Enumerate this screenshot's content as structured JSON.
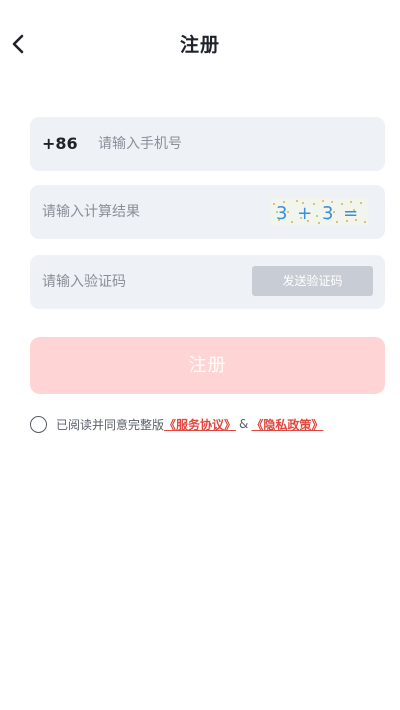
{
  "header": {
    "title": "注册"
  },
  "form": {
    "phone": {
      "prefix": "+86",
      "placeholder": "请输入手机号"
    },
    "calc": {
      "placeholder": "请输入计算结果",
      "captcha_text": "3 + 3 ="
    },
    "code": {
      "placeholder": "请输入验证码",
      "send_label": "发送验证码"
    },
    "submit_label": "注册"
  },
  "agreement": {
    "prefix": "已阅读并同意完整版",
    "service_link": "《服务协议》",
    "separator": "&",
    "privacy_link": "《隐私政策》"
  },
  "colors": {
    "field_bg": "#eef1f5",
    "submit_bg": "#ffd4d4",
    "send_bg": "#c8ccd4",
    "link": "#e2473f"
  },
  "icons": {
    "back": "chevron-left-icon",
    "radio": "radio-unchecked-icon"
  }
}
